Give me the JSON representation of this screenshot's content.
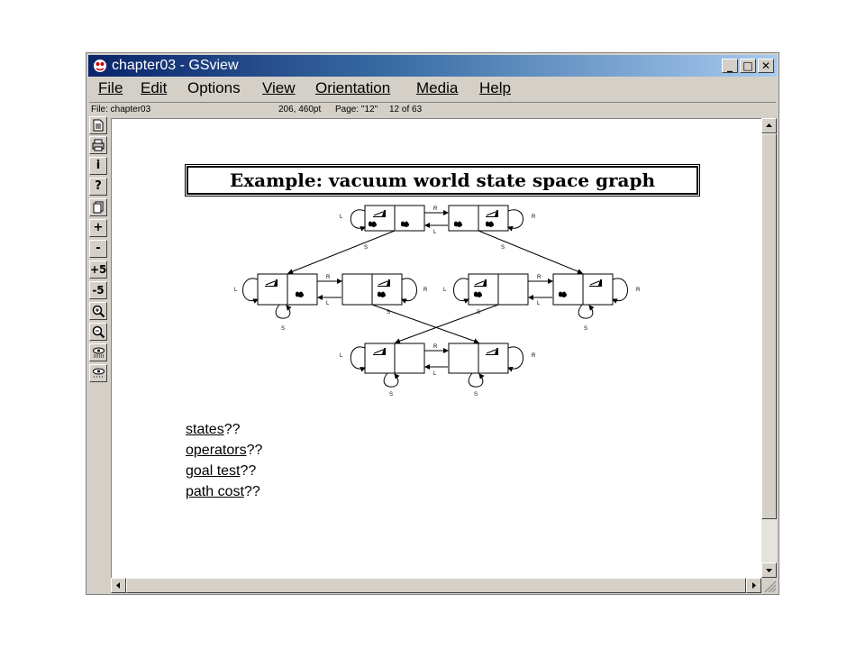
{
  "window": {
    "title": "chapter03 - GSview",
    "controls": {
      "minimize": "_",
      "maximize": "□",
      "close": "✕"
    }
  },
  "menu": [
    {
      "label": "File"
    },
    {
      "label": "Edit"
    },
    {
      "label": "Options"
    },
    {
      "label": "View"
    },
    {
      "label": "Orientation"
    },
    {
      "label": "Media"
    },
    {
      "label": "Help"
    }
  ],
  "status": {
    "file": "File: chapter03",
    "coords": "206, 460pt",
    "page_label": "Page: \"12\"",
    "page_position": "12 of 63"
  },
  "toolbar": {
    "info": "i",
    "help": "?",
    "zoom_in_small": "+",
    "zoom_out_small": "-",
    "next5": "+5",
    "prev5": "-5"
  },
  "slide": {
    "title": "Example: vacuum world state space graph",
    "questions": [
      {
        "term": "states",
        "suffix": "??"
      },
      {
        "term": "operators",
        "suffix": "??"
      },
      {
        "term": "goal test",
        "suffix": "??"
      },
      {
        "term": "path cost",
        "suffix": "??"
      }
    ],
    "graph_labels": {
      "right": "R",
      "left": "L",
      "suck": "S"
    }
  },
  "colors": {
    "title_start": "#0a246a",
    "title_end": "#a6caf0",
    "chrome": "#d4d0c8"
  }
}
